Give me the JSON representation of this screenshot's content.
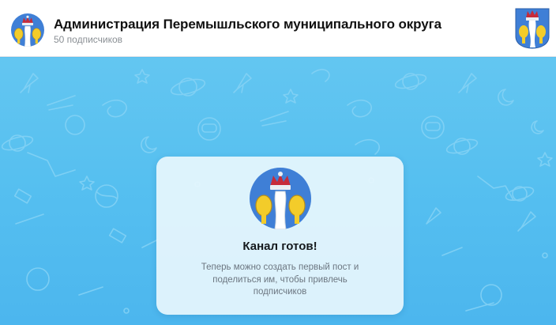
{
  "channel": {
    "title": "Администрация Перемышльского муниципального округа",
    "subscribers": "50 подписчиков"
  },
  "card": {
    "title": "Канал готов!",
    "text": "Теперь можно создать первый пост и поделиться им, чтобы привлечь подписчиков"
  },
  "colors": {
    "wallpaper": "#5cc0f0",
    "emblem_field": "#3f7fd6",
    "emblem_gold": "#f3cc2a",
    "emblem_crown": "#c62b3a"
  }
}
